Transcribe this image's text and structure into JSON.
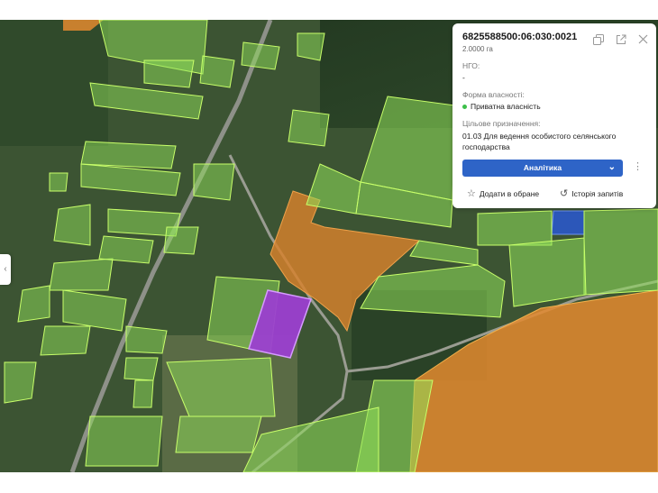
{
  "parcel": {
    "cadastral_number": "6825588500:06:030:0021",
    "area": "2.0000 га",
    "ngo_label": "НГО:",
    "ngo_value": "-",
    "ownership_label": "Форма власності:",
    "ownership_value": "Приватна власність",
    "purpose_label": "Цільове призначення:",
    "purpose_value": "01.03 Для ведення особистого селянського господарства"
  },
  "actions": {
    "analytics_label": "Аналітика",
    "favorite_label": "Додати в обране",
    "history_label": "Історія запитів"
  },
  "icons": {
    "copy": "copy-icon",
    "open": "external-link-icon",
    "close": "close-icon",
    "chevron": "chevron-down-icon",
    "more": "more-vertical-icon",
    "star": "star-icon",
    "history": "history-icon",
    "left_collapse": "chevron-left-icon"
  },
  "colors": {
    "private_status": "#3cbf4a",
    "selected_parcel": "#9b3fd0",
    "accent_button": "#2e64c7",
    "parcel_green": "#8fe05a",
    "parcel_orange": "#e38a2f",
    "parcel_blue": "#2a58c8"
  }
}
